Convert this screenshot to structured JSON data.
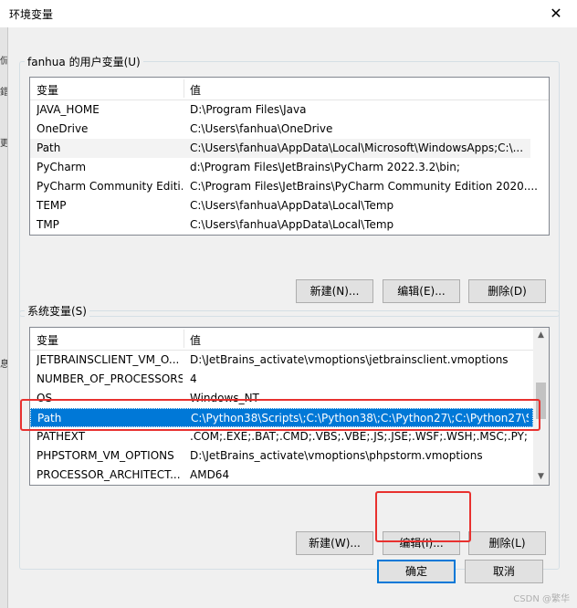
{
  "window": {
    "title": "环境变量",
    "close_glyph": "✕"
  },
  "left_strip": [
    "侃",
    "錯",
    "更",
    "息"
  ],
  "user_vars": {
    "group_label": "fanhua 的用户变量(U)",
    "columns": [
      "变量",
      "值"
    ],
    "rows": [
      {
        "name": "JAVA_HOME",
        "value": "D:\\Program Files\\Java"
      },
      {
        "name": "OneDrive",
        "value": "C:\\Users\\fanhua\\OneDrive"
      },
      {
        "name": "Path",
        "value": "C:\\Users\\fanhua\\AppData\\Local\\Microsoft\\WindowsApps;C:\\..."
      },
      {
        "name": "PyCharm",
        "value": "d:\\Program Files\\JetBrains\\PyCharm 2022.3.2\\bin;"
      },
      {
        "name": "PyCharm Community Editi...",
        "value": "C:\\Program Files\\JetBrains\\PyCharm Community Edition 2020...."
      },
      {
        "name": "TEMP",
        "value": "C:\\Users\\fanhua\\AppData\\Local\\Temp"
      },
      {
        "name": "TMP",
        "value": "C:\\Users\\fanhua\\AppData\\Local\\Temp"
      }
    ],
    "buttons": {
      "new": "新建(N)...",
      "edit": "编辑(E)...",
      "delete": "删除(D)"
    }
  },
  "sys_vars": {
    "group_label": "系统变量(S)",
    "columns": [
      "变量",
      "值"
    ],
    "rows": [
      {
        "name": "JETBRAINSCLIENT_VM_O...",
        "value": "D:\\JetBrains_activate\\vmoptions\\jetbrainsclient.vmoptions"
      },
      {
        "name": "NUMBER_OF_PROCESSORS",
        "value": "4"
      },
      {
        "name": "OS",
        "value": "Windows_NT"
      },
      {
        "name": "Path",
        "value": "C:\\Python38\\Scripts\\;C:\\Python38\\;C:\\Python27\\;C:\\Python27\\S..."
      },
      {
        "name": "PATHEXT",
        "value": ".COM;.EXE;.BAT;.CMD;.VBS;.VBE;.JS;.JSE;.WSF;.WSH;.MSC;.PY;.P..."
      },
      {
        "name": "PHPSTORM_VM_OPTIONS",
        "value": "D:\\JetBrains_activate\\vmoptions\\phpstorm.vmoptions"
      },
      {
        "name": "PROCESSOR_ARCHITECT...",
        "value": "AMD64"
      }
    ],
    "selected_index": 3,
    "buttons": {
      "new": "新建(W)...",
      "edit": "编辑(I)...",
      "delete": "删除(L)"
    }
  },
  "footer": {
    "ok": "确定",
    "cancel": "取消"
  },
  "watermark": "CSDN @繁华",
  "colors": {
    "selection": "#0078d7",
    "highlight_box": "#e8312f"
  }
}
